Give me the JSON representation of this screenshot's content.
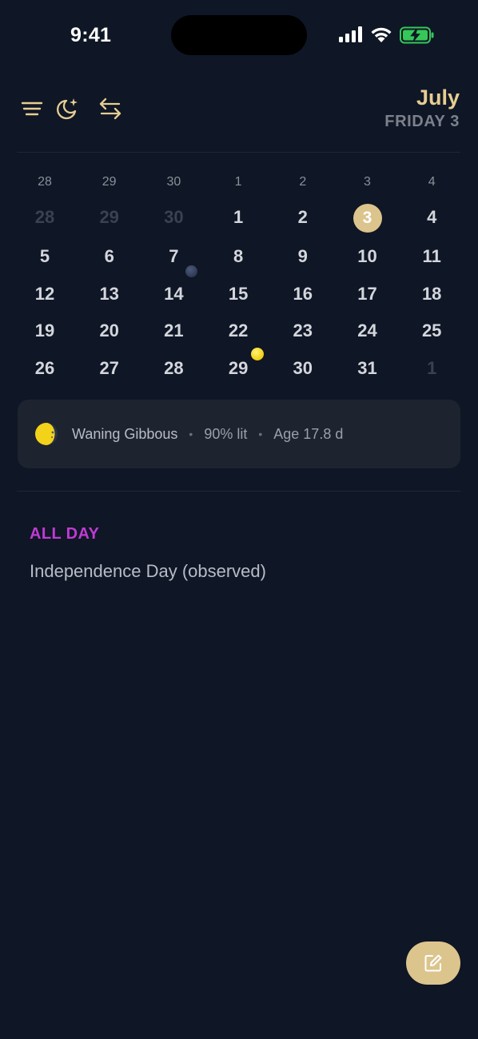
{
  "status_bar": {
    "time": "9:41"
  },
  "header": {
    "icons": [
      "menu-icon",
      "night-mode-icon",
      "swap-arrows-icon"
    ],
    "month": "July",
    "day_label": "FRIDAY 3"
  },
  "calendar": {
    "weekday_labels": [
      "28",
      "29",
      "30",
      "1",
      "2",
      "3",
      "4"
    ],
    "weeks": [
      [
        {
          "d": "28",
          "dim": true
        },
        {
          "d": "29",
          "dim": true
        },
        {
          "d": "30",
          "dim": true
        },
        {
          "d": "1"
        },
        {
          "d": "2"
        },
        {
          "d": "3",
          "selected": true
        },
        {
          "d": "4"
        }
      ],
      [
        {
          "d": "5"
        },
        {
          "d": "6"
        },
        {
          "d": "7"
        },
        {
          "d": "8"
        },
        {
          "d": "9"
        },
        {
          "d": "10"
        },
        {
          "d": "11"
        }
      ],
      [
        {
          "d": "12"
        },
        {
          "d": "13"
        },
        {
          "d": "14",
          "moon": "new"
        },
        {
          "d": "15"
        },
        {
          "d": "16"
        },
        {
          "d": "17"
        },
        {
          "d": "18"
        }
      ],
      [
        {
          "d": "19"
        },
        {
          "d": "20"
        },
        {
          "d": "21"
        },
        {
          "d": "22"
        },
        {
          "d": "23"
        },
        {
          "d": "24"
        },
        {
          "d": "25"
        }
      ],
      [
        {
          "d": "26"
        },
        {
          "d": "27"
        },
        {
          "d": "28"
        },
        {
          "d": "29",
          "moon": "full"
        },
        {
          "d": "30"
        },
        {
          "d": "31"
        },
        {
          "d": "1",
          "dim": true
        }
      ]
    ]
  },
  "moon": {
    "phase": "Waning Gibbous",
    "illumination": "90% lit",
    "age": "Age 17.8 d",
    "separator": "•"
  },
  "events": {
    "section_label": "ALL DAY",
    "items": [
      {
        "title": "Independence Day (observed)"
      }
    ]
  },
  "colors": {
    "accent": "#dcc48d",
    "month_title": "#e6cd92",
    "all_day": "#c03ad6",
    "full_moon": "#f3d21a",
    "new_moon": "#2e3a52",
    "background": "#0f1625"
  },
  "fab": {
    "icon": "edit-icon"
  }
}
